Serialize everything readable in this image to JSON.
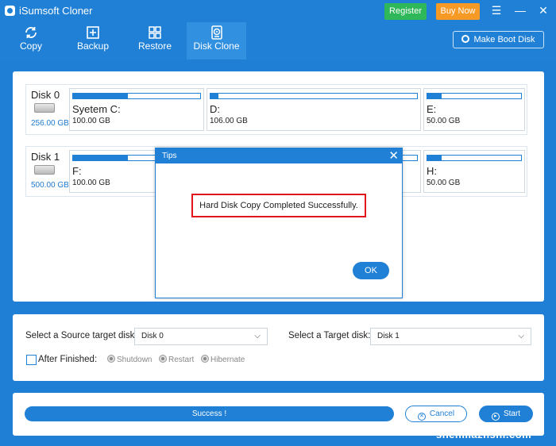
{
  "app": {
    "title": "iSumsoft Cloner",
    "register_label": "Register",
    "buynow_label": "Buy Now",
    "menu_glyph": "☰",
    "minimize_glyph": "—",
    "close_glyph": "✕"
  },
  "toolbar": {
    "items": [
      {
        "label": "Copy",
        "icon": "copy-icon"
      },
      {
        "label": "Backup",
        "icon": "backup-icon"
      },
      {
        "label": "Restore",
        "icon": "restore-icon"
      },
      {
        "label": "Disk Clone",
        "icon": "disk-clone-icon",
        "active": true
      }
    ],
    "make_boot_disk_label": "Make Boot Disk"
  },
  "disks": [
    {
      "name": "Disk 0",
      "size": "256.00 GB",
      "partitions": [
        {
          "label": "Syetem C:",
          "size": "100.00 GB",
          "used_fraction": 0.43
        },
        {
          "label": "D:",
          "size": "106.00 GB",
          "used_fraction": 0.04
        },
        {
          "label": "E:",
          "size": "50.00 GB",
          "used_fraction": 0.15
        }
      ]
    },
    {
      "name": "Disk 1",
      "size": "500.00 GB",
      "partitions": [
        {
          "label": "F:",
          "size": "100.00 GB",
          "used_fraction": 0.43
        },
        {
          "label": "H:",
          "size": "50.00 GB",
          "used_fraction": 0.15
        }
      ]
    }
  ],
  "dialog": {
    "title": "Tips",
    "message": "Hard Disk Copy Completed Successfully.",
    "ok_label": "OK"
  },
  "options": {
    "source_label": "Select a Source target disk:",
    "source_value": "Disk 0",
    "target_label": "Select a Target disk:",
    "target_value": "Disk 1",
    "after_finished_label": "After Finished:",
    "after_finished_checked": false,
    "radios": [
      "Shutdown",
      "Restart",
      "Hibernate"
    ]
  },
  "bottom": {
    "progress_text": "Success !",
    "progress_fraction": 1.0,
    "cancel_label": "Cancel",
    "start_label": "Start"
  },
  "watermark": "shenmazhshi.com",
  "colors": {
    "brand_blue": "#1f80d6",
    "register_green": "#2fb85a",
    "buynow_orange": "#f79a25",
    "highlight_red": "#e0161b"
  }
}
